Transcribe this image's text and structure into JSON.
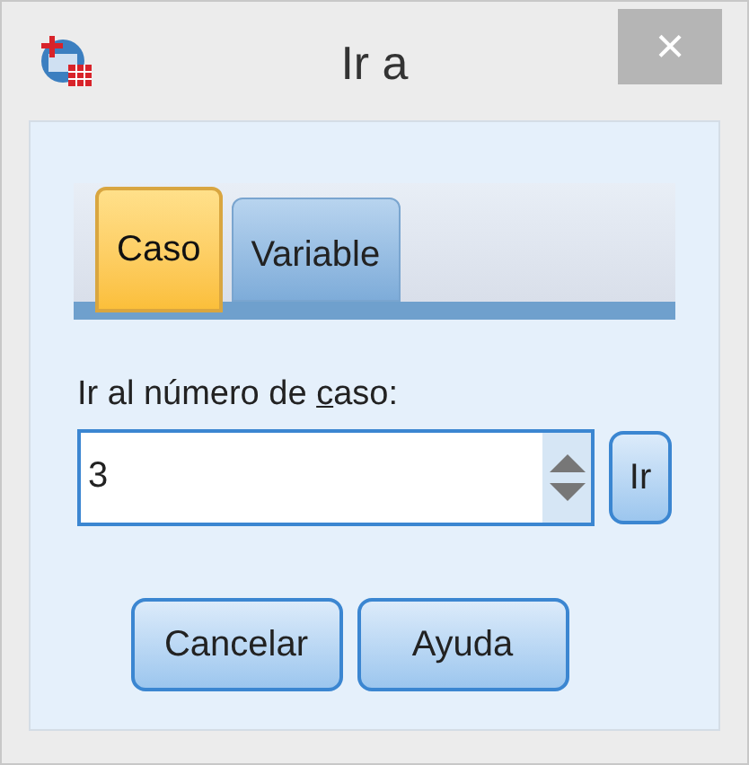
{
  "window": {
    "title": "Ir a",
    "close": "×"
  },
  "tabs": [
    {
      "label": "Caso",
      "selected": true
    },
    {
      "label": "Variable",
      "selected": false
    }
  ],
  "case_field": {
    "label_before": "Ir al número de ",
    "label_key": "c",
    "label_after": "aso:",
    "value": "3"
  },
  "go_button": "Ir",
  "buttons": [
    "Cancelar",
    "Ayuda"
  ]
}
